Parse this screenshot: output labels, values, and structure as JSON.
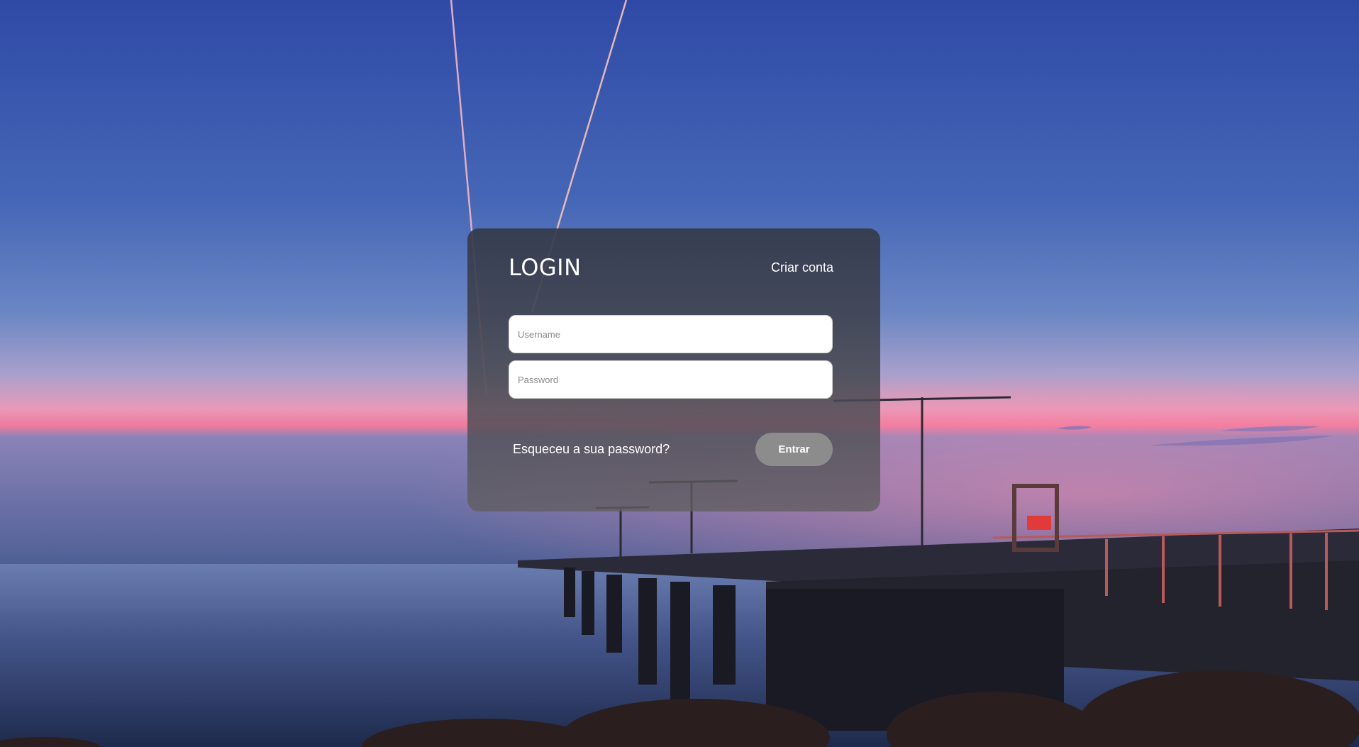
{
  "login": {
    "title": "LOGIN",
    "create_account_label": "Criar conta",
    "username_placeholder": "Username",
    "password_placeholder": "Password",
    "forgot_password_label": "Esqueceu a sua password?",
    "submit_label": "Entrar"
  },
  "background": {
    "scene": "pier-at-dusk-photo",
    "colors": {
      "sky_top": "#3550a8",
      "sky_mid": "#5b7cc0",
      "sunset_pink": "#e87aa8",
      "sea": "#3a4a78"
    }
  }
}
